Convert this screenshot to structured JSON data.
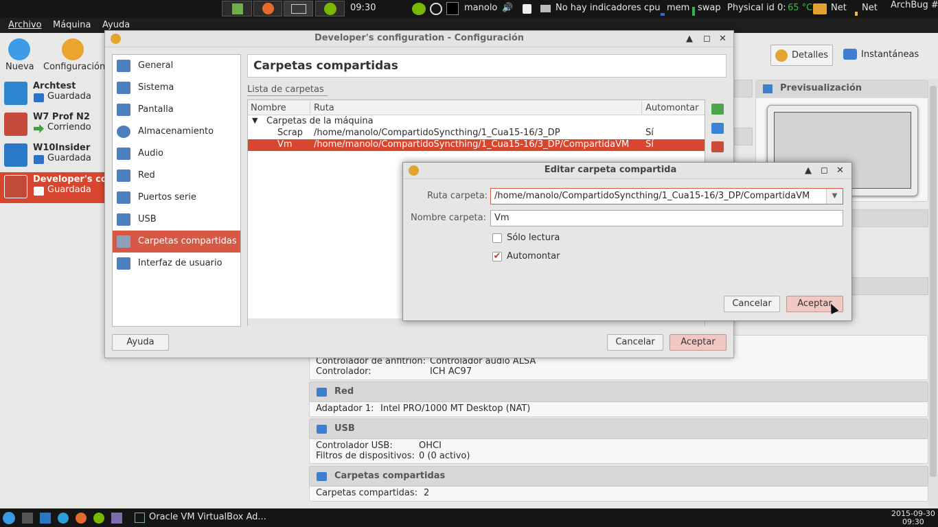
{
  "top_panel": {
    "clock": "09:30",
    "user": "manolo",
    "indicators": "No hay indicadores cpu",
    "mem": "mem",
    "swap": "swap",
    "physical": "Physical id 0:",
    "temp": "65 °C",
    "net1": "Net",
    "net2": "Net",
    "archbug": "ArchBug #"
  },
  "menubar": {
    "archivo": "Archivo",
    "maquina": "Máquina",
    "ayuda": "Ayuda"
  },
  "toolbar": {
    "nueva": "Nueva",
    "configuracion": "Configuración",
    "detalles": "Detalles",
    "instantaneas": "Instantáneas"
  },
  "vms": [
    {
      "name": "Archtest",
      "state": "Guardada",
      "badge": "64"
    },
    {
      "name": "W7 Prof N2",
      "state": "Corriendo",
      "badge": "7"
    },
    {
      "name": "W10Insider",
      "state": "Guardada",
      "badge": "10"
    },
    {
      "name": "Developer's co",
      "state": "Guardada",
      "badge": "xp"
    }
  ],
  "details": {
    "preview_title": "Previsualización",
    "audio_host_label": "Controlador de anfitrión:",
    "audio_host_value": "Controlador audio ALSA",
    "audio_ctrl_label": "Controlador:",
    "audio_ctrl_value": "ICH AC97",
    "red_title": "Red",
    "red_adapter_label": "Adaptador 1:",
    "red_adapter_value": "Intel PRO/1000 MT Desktop (NAT)",
    "usb_title": "USB",
    "usb_ctrl_label": "Controlador USB:",
    "usb_ctrl_value": "OHCI",
    "usb_filter_label": "Filtros de dispositivos:",
    "usb_filter_value": "0 (0 activo)",
    "shared_title": "Carpetas compartidas",
    "shared_label": "Carpetas compartidas:",
    "shared_value": "2"
  },
  "config_dialog": {
    "title": "Developer's configuration - Configuración",
    "categories": [
      "General",
      "Sistema",
      "Pantalla",
      "Almacenamiento",
      "Audio",
      "Red",
      "Puertos serie",
      "USB",
      "Carpetas compartidas",
      "Interfaz de usuario"
    ],
    "page_title": "Carpetas compartidas",
    "list_label": "Lista de carpetas",
    "columns": [
      "Nombre",
      "Ruta",
      "Automontar"
    ],
    "group": "Carpetas de la máquina",
    "rows": [
      {
        "name": "Scrap",
        "path": "/home/manolo/CompartidoSyncthing/1_Cua15-16/3_DP",
        "auto": "Sí"
      },
      {
        "name": "Vm",
        "path": "/home/manolo/CompartidoSyncthing/1_Cua15-16/3_DP/CompartidaVM",
        "auto": "Sí"
      }
    ],
    "help": "Ayuda",
    "cancel": "Cancelar",
    "ok": "Aceptar"
  },
  "edit_dialog": {
    "title": "Editar carpeta compartida",
    "path_label": "Ruta carpeta:",
    "path_value": "/home/manolo/CompartidoSyncthing/1_Cua15-16/3_DP/CompartidaVM",
    "name_label": "Nombre carpeta:",
    "name_value": "Vm",
    "readonly_label": "Sólo lectura",
    "automount_label": "Automontar",
    "cancel": "Cancelar",
    "ok": "Aceptar"
  },
  "taskbar": {
    "window": "Oracle VM VirtualBox Ad...",
    "date": "2015-09-30",
    "time": "09:30"
  }
}
